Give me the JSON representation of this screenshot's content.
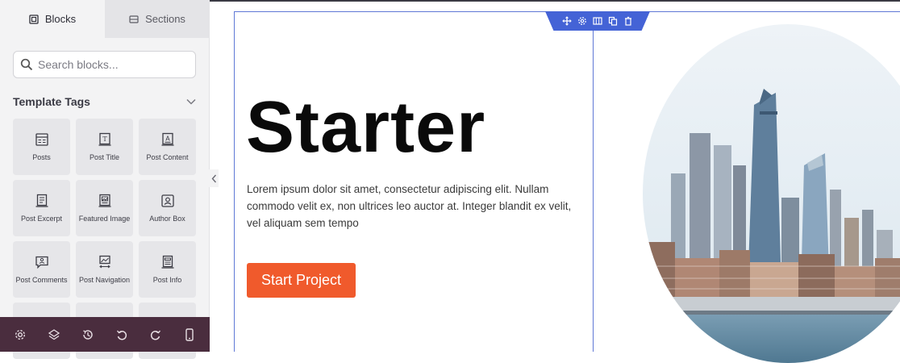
{
  "sidebar": {
    "tabs": [
      {
        "label": "Blocks",
        "icon": "blocks-icon",
        "active": true
      },
      {
        "label": "Sections",
        "icon": "sections-icon",
        "active": false
      }
    ],
    "search": {
      "placeholder": "Search blocks..."
    },
    "category": {
      "title": "Template Tags"
    },
    "blocks": [
      {
        "label": "Posts",
        "icon": "posts-icon"
      },
      {
        "label": "Post Title",
        "icon": "post-title-icon"
      },
      {
        "label": "Post Content",
        "icon": "post-content-icon"
      },
      {
        "label": "Post Excerpt",
        "icon": "post-excerpt-icon"
      },
      {
        "label": "Featured Image",
        "icon": "featured-image-icon"
      },
      {
        "label": "Author Box",
        "icon": "author-box-icon"
      },
      {
        "label": "Post Comments",
        "icon": "post-comments-icon"
      },
      {
        "label": "Post Navigation",
        "icon": "post-navigation-icon"
      },
      {
        "label": "Post Info",
        "icon": "post-info-icon"
      }
    ],
    "toolbar": [
      "settings-icon",
      "layers-icon",
      "history-icon",
      "undo-icon",
      "redo-icon",
      "mobile-preview-icon"
    ]
  },
  "canvas": {
    "column_toolbar": [
      "move-icon",
      "settings-icon",
      "columns-icon",
      "duplicate-icon",
      "delete-icon"
    ],
    "headline": "Starter",
    "paragraph": "Lorem ipsum dolor sit amet, consectetur adipiscing elit. Nullam commodo velit ex, non ultrices leo auctor at. Integer blandit ex velit, vel aliquam sem tempo",
    "cta_label": "Start Project",
    "image_alt": "city skyline"
  },
  "colors": {
    "accent": "#4463d6",
    "cta": "#f05a2c",
    "toolbar_bg": "#4a2d3e"
  }
}
